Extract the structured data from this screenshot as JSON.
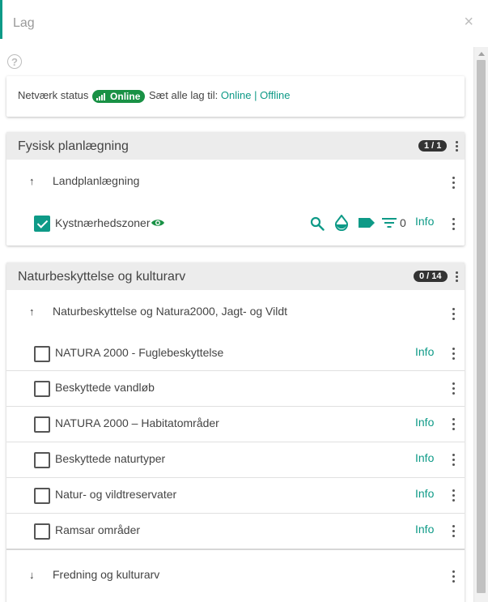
{
  "panel": {
    "title": "Lag",
    "close_glyph": "×",
    "help_glyph": "?"
  },
  "status": {
    "label": "Netværk status",
    "badge": "Online",
    "set_all": "Sæt alle lag til:",
    "online_link": "Online",
    "separator": "|",
    "offline_link": "Offline"
  },
  "groups": [
    {
      "title": "Fysisk planlægning",
      "count": "1 / 1",
      "subgroups": [
        {
          "arrow": "↑",
          "label": "Landplanlægning",
          "layers": [
            {
              "label": "Kystnærhedszoner",
              "checked": true,
              "visible_icon": "eye-icon",
              "filter_count": "0",
              "info": "Info"
            }
          ]
        }
      ]
    },
    {
      "title": "Naturbeskyttelse og kulturarv",
      "count": "0 / 14",
      "subgroups": [
        {
          "arrow": "↑",
          "label": "Naturbeskyttelse og Natura2000, Jagt- og Vildt",
          "layers": [
            {
              "label": "NATURA 2000 - Fuglebeskyttelse",
              "checked": false,
              "info": "Info"
            },
            {
              "label": "Beskyttede vandløb",
              "checked": false,
              "info": ""
            },
            {
              "label": "NATURA 2000 – Habitatområder",
              "checked": false,
              "info": "Info"
            },
            {
              "label": "Beskyttede naturtyper",
              "checked": false,
              "info": "Info"
            },
            {
              "label": "Natur- og vildtreservater",
              "checked": false,
              "info": "Info"
            },
            {
              "label": "Ramsar områder",
              "checked": false,
              "info": "Info"
            }
          ]
        },
        {
          "arrow": "↓",
          "label": "Fredning og kulturarv"
        }
      ]
    }
  ],
  "colors": {
    "accent": "#0e9a87",
    "online": "#199145",
    "count_badge": "#333333"
  }
}
